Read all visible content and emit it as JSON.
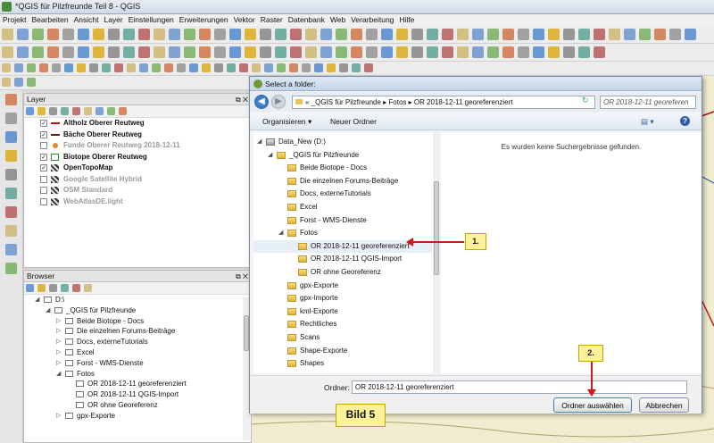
{
  "window": {
    "title": "*QGIS für Pilzfreunde Teil 8 - QGIS"
  },
  "menu": [
    "Projekt",
    "Bearbeiten",
    "Ansicht",
    "Layer",
    "Einstellungen",
    "Erweiterungen",
    "Vektor",
    "Raster",
    "Datenbank",
    "Web",
    "Verarbeitung",
    "Hilfe"
  ],
  "layers_panel": {
    "title": "Layer",
    "items": [
      {
        "label": "Altholz Oberer Reutweg",
        "checked": true,
        "style": "bold",
        "symbol": "line-red"
      },
      {
        "label": "Bäche Oberer Reutweg",
        "checked": true,
        "style": "bold",
        "symbol": "line-darkred"
      },
      {
        "label": "Funde Oberer Reutweg 2018-12-11",
        "checked": false,
        "style": "grey",
        "symbol": "point-orange"
      },
      {
        "label": "Biotope Oberer Reutweg",
        "checked": true,
        "style": "bold",
        "symbol": "polygon-green"
      },
      {
        "label": "OpenTopoMap",
        "checked": true,
        "style": "bold",
        "symbol": "raster"
      },
      {
        "label": "Google Satellite Hybrid",
        "checked": false,
        "style": "grey",
        "symbol": "raster"
      },
      {
        "label": "OSM Standard",
        "checked": false,
        "style": "grey",
        "symbol": "raster"
      },
      {
        "label": "WebAtlasDE.light",
        "checked": false,
        "style": "grey",
        "symbol": "raster"
      }
    ]
  },
  "browser_panel": {
    "title": "Browser",
    "items": [
      {
        "label": "D:\\",
        "indent": 1,
        "expanded": true
      },
      {
        "label": "_QGIS für Pilzfreunde",
        "indent": 2,
        "expanded": true
      },
      {
        "label": "Beide Biotope - Docs",
        "indent": 3
      },
      {
        "label": "Die einzelnen Forums-Beiträge",
        "indent": 3
      },
      {
        "label": "Docs, externeTutorials",
        "indent": 3
      },
      {
        "label": "Excel",
        "indent": 3
      },
      {
        "label": "Forst - WMS-Dienste",
        "indent": 3
      },
      {
        "label": "Fotos",
        "indent": 3,
        "expanded": true
      },
      {
        "label": "OR 2018-12-11 georeferenziert",
        "indent": 4
      },
      {
        "label": "OR 2018-12-11 QGIS-Import",
        "indent": 4
      },
      {
        "label": "OR ohne Georeferenz",
        "indent": 4
      },
      {
        "label": "gpx-Exporte",
        "indent": 3
      }
    ]
  },
  "dialog": {
    "title": "Select a folder:",
    "breadcrumb": "«  _QGIS für Pilzfreunde  ▸  Fotos  ▸  OR 2018-12-11 georeferenziert",
    "search_placeholder": "OR 2018-12-11 georeferen",
    "organize_label": "Organisieren ▾",
    "new_folder_label": "Neuer Ordner",
    "tree": [
      {
        "label": "Data_New (D:)",
        "indent": 0,
        "drive": true
      },
      {
        "label": "_QGIS für Pilzfreunde",
        "indent": 1
      },
      {
        "label": "Beide Biotope - Docs",
        "indent": 2
      },
      {
        "label": "Die einzelnen Forums-Beiträge",
        "indent": 2
      },
      {
        "label": "Docs, externeTutorials",
        "indent": 2
      },
      {
        "label": "Excel",
        "indent": 2
      },
      {
        "label": "Forst - WMS-Dienste",
        "indent": 2
      },
      {
        "label": "Fotos",
        "indent": 2
      },
      {
        "label": "OR 2018-12-11 georeferenziert",
        "indent": 3,
        "selected": true
      },
      {
        "label": "OR 2018-12-11 QGIS-Import",
        "indent": 3
      },
      {
        "label": "OR ohne Georeferenz",
        "indent": 3
      },
      {
        "label": "gpx-Exporte",
        "indent": 2
      },
      {
        "label": "gpx-Importe",
        "indent": 2
      },
      {
        "label": "kml-Exporte",
        "indent": 2
      },
      {
        "label": "Rechtliches",
        "indent": 2
      },
      {
        "label": "Scans",
        "indent": 2
      },
      {
        "label": "Shape-Exporte",
        "indent": 2
      },
      {
        "label": "Shapes",
        "indent": 2
      }
    ],
    "no_results": "Es wurden keine Suchergebnisse gefunden.",
    "folder_label": "Ordner:",
    "folder_value": "OR 2018-12-11 georeferenziert",
    "select_button": "Ordner auswählen",
    "cancel_button": "Abbrechen"
  },
  "annotations": {
    "callout1": "1.",
    "callout2": "2.",
    "bild": "Bild 5"
  },
  "colors": {
    "accent": "#1c5aa8",
    "callout_bg": "#fdf29a",
    "arrow": "#d01818",
    "map_bg": "#f1ebcf"
  }
}
